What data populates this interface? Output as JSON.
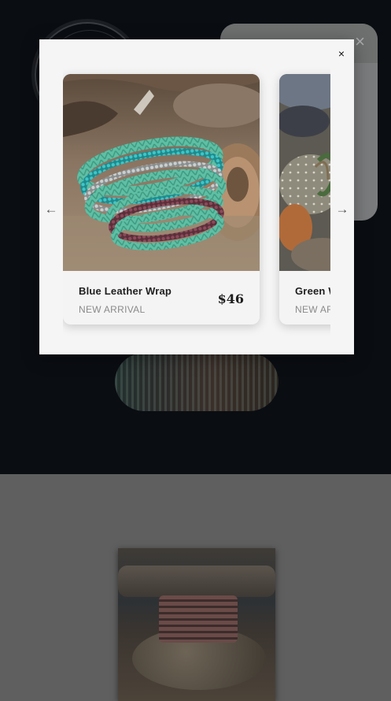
{
  "modal": {
    "close_label": "×",
    "prev_label": "←",
    "next_label": "→"
  },
  "products": [
    {
      "name": "Blue Leather Wrap",
      "tag": "NEW ARRIVAL",
      "price": "$46",
      "image_icon": "turquoise-bracelet-photo"
    },
    {
      "name": "Green W",
      "tag": "NEW AR",
      "image_icon": "stones-bracelet-photo"
    }
  ],
  "background": {
    "panel_close_label": "×"
  },
  "colors": {
    "modal_bg": "#f5f5f5",
    "overlay_top": "#0a0d12",
    "overlay_bottom": "#5f5f5f",
    "text_primary": "#1e1e1e",
    "text_secondary": "#8a8a8a"
  }
}
